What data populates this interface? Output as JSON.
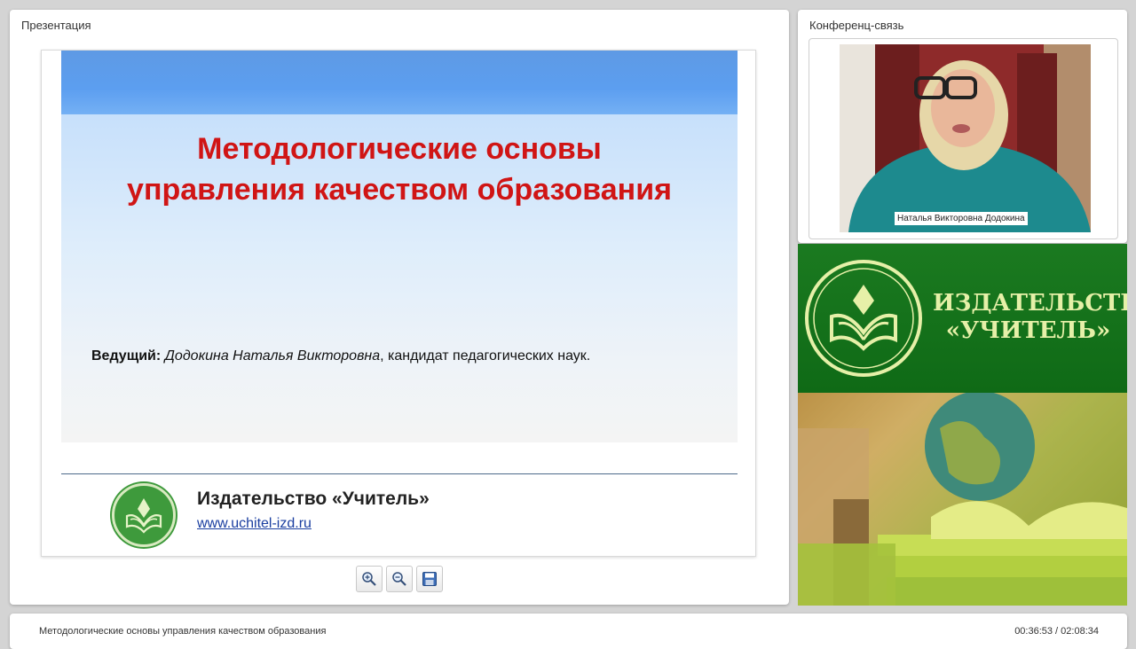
{
  "presentation": {
    "panel_title": "Презентация",
    "slide": {
      "title_line1": "Методологические основы",
      "title_line2": "управления качеством образования",
      "host_label": "Ведущий:",
      "host_name": "Додокина Наталья Викторовна",
      "host_suffix": ", кандидат педагогических наук.",
      "publisher": "Издательство «Учитель»",
      "url": "www.uchitel-izd.ru"
    },
    "toolbar": {
      "zoom_in_icon": "zoom-in-icon",
      "zoom_out_icon": "zoom-out-icon",
      "save_icon": "save-icon"
    }
  },
  "conference": {
    "panel_title": "Конференц-связь",
    "speaker_name": "Наталья Викторовна Додокина"
  },
  "banner": {
    "title_line1": "ИЗДАТЕЛЬСТВО",
    "title_line2": "«УЧИТЕЛЬ»"
  },
  "footer": {
    "title": "Методологические основы управления качеством образования",
    "time": "00:36:53 / 02:08:34"
  },
  "colors": {
    "slide_title": "#d01515",
    "banner_green": "#0f6a16",
    "banner_text": "#e6f0a8",
    "link": "#1a3ea0"
  }
}
